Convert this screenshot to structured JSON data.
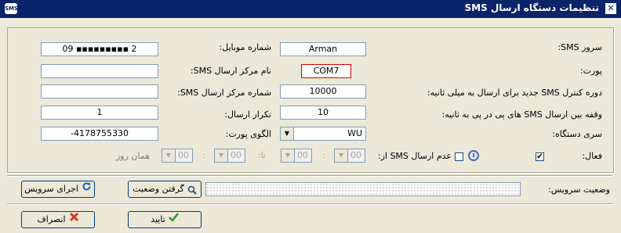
{
  "window": {
    "title": "تنظیمات دستگاه ارسال SMS",
    "app_icon": "SMS",
    "close_icon": "✕"
  },
  "form": {
    "sms_server_label": "سرور SMS:",
    "sms_server_value": "Arman",
    "port_label": "پورت:",
    "port_value": "COM7",
    "control_period_label": "دوره کنترل SMS جدید برای ارسال به میلی ثانیه:",
    "control_period_value": "10000",
    "pause_label": "وقفه بین ارسال SMS های پی در پی به ثانیه:",
    "pause_value": "10",
    "device_series_label": "سری دستگاه:",
    "device_series_value": "WU",
    "active_label": "فعال:",
    "active_checked": "✔",
    "mobile_label": "شماره موبایل:",
    "mobile_value": "09 ▪▪▪▪▪▪▪▪▪ 2",
    "center_name_label": "نام مرکز ارسال SMS:",
    "center_name_value": "",
    "center_number_label": "شماره مرکز ارسال SMS:",
    "center_number_value": "",
    "repeat_label": "تکرار ارسال:",
    "repeat_value": "1",
    "port_pattern_label": "الگوی پورت:",
    "port_pattern_value": "-4178755330",
    "no_send_label": "عدم ارسال SMS از:",
    "to_label": "تا:",
    "same_day_label": "همان روز",
    "time_values": [
      "00",
      "00",
      "00",
      "00"
    ],
    "time_colon": ":"
  },
  "service": {
    "status_label": "وضعیت سرویس:",
    "status_value": "",
    "get_status_label": "گرفتن وضعیت",
    "run_service_label": "اجرای سرویس"
  },
  "footer": {
    "ok_label": "تایید",
    "cancel_label": "انصراف"
  }
}
